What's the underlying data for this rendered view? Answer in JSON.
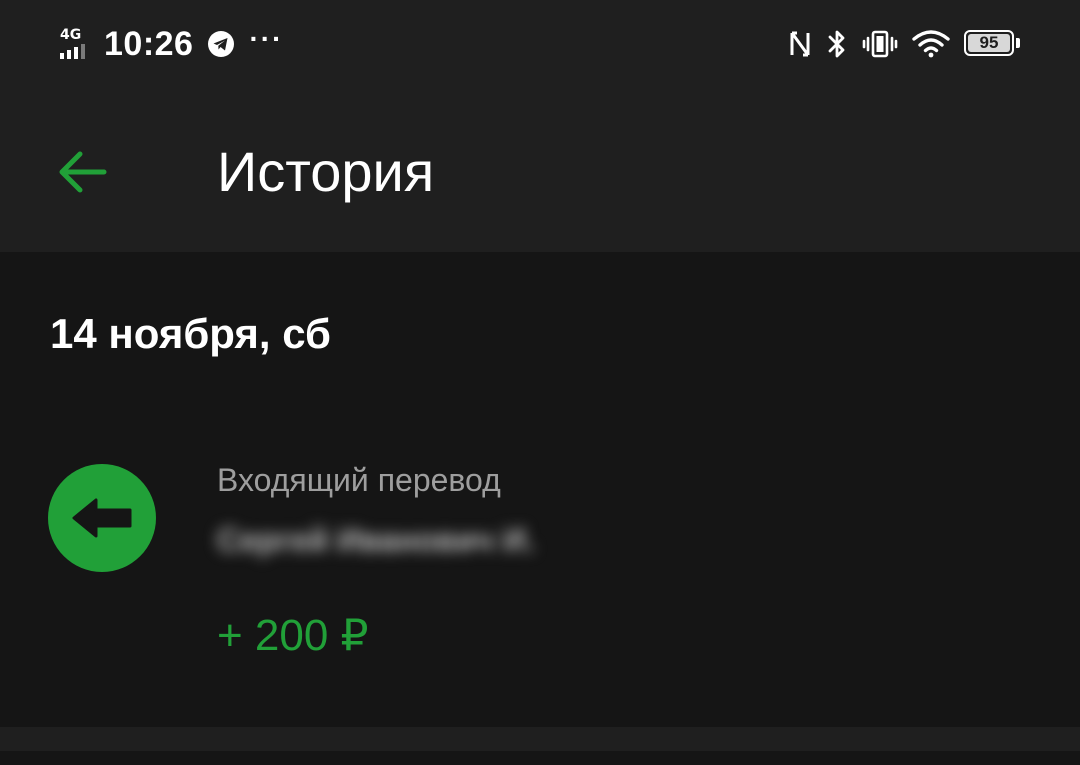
{
  "status_bar": {
    "network_type": "4G",
    "time": "10:26",
    "telegram_icon": "telegram-icon",
    "overflow": "···",
    "nfc_icon": "nfc-icon",
    "bluetooth_icon": "bluetooth-icon",
    "vibrate_icon": "vibrate-icon",
    "wifi_icon": "wifi-icon",
    "battery_level": "95"
  },
  "app_bar": {
    "back_icon": "arrow-left-icon",
    "title": "История"
  },
  "history": {
    "date_header": "14 ноября, сб",
    "transactions": [
      {
        "icon": "incoming-arrow-icon",
        "type": "Входящий перевод",
        "counterparty": "Сергей Иванович И.",
        "amount": "+ 200 ₽"
      }
    ]
  },
  "colors": {
    "accent_green": "#21a038",
    "background_dark": "#151515",
    "bar_background": "#1f1f1f",
    "secondary_text": "#9e9e9e"
  }
}
